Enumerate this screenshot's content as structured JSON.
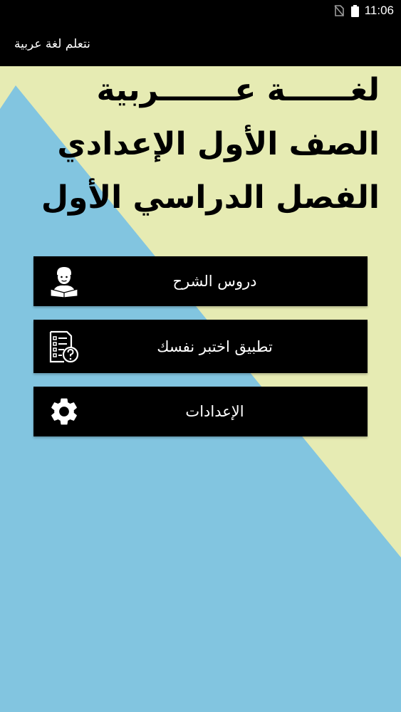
{
  "status_bar": {
    "time": "11:06",
    "icons": [
      "no-sim-icon",
      "battery-icon"
    ]
  },
  "app_bar": {
    "title": "نتعلم لغة عربية"
  },
  "headline": {
    "line1": "لغــــــة عـــــــربية",
    "line2": "الصف الأول الإعدادي",
    "line3": "الفصل الدراسي الأول"
  },
  "menu": {
    "lessons": {
      "label": "دروس الشرح",
      "icon": "reading-student-icon"
    },
    "test": {
      "label": "تطبيق اختبر نفسك",
      "icon": "quiz-checklist-icon"
    },
    "settings": {
      "label": "الإعدادات",
      "icon": "gear-icon"
    }
  },
  "colors": {
    "bars": "#000000",
    "background_blue": "#82c5e0",
    "background_yellow": "#e6ebb3",
    "button": "#000000",
    "button_text": "#ffffff"
  }
}
